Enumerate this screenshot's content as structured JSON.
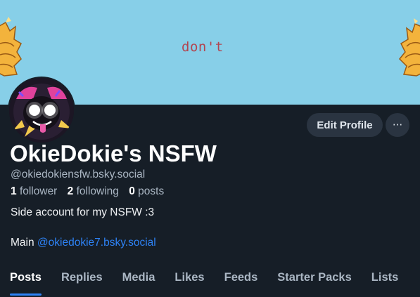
{
  "banner": {
    "text": "don't",
    "background_color": "#87cfe8"
  },
  "profile": {
    "display_name": "OkieDokie's NSFW",
    "handle": "@okiedokiensfw.bsky.social",
    "stats": {
      "followers_count": "1",
      "followers_label": "follower",
      "following_count": "2",
      "following_label": "following",
      "posts_count": "0",
      "posts_label": "posts"
    },
    "bio": {
      "line1": "Side account for my NSFW :3",
      "line2_prefix": "Main",
      "line2_mention": "@okiedokie7.bsky.social"
    }
  },
  "actions": {
    "edit_profile_label": "Edit Profile",
    "more_icon": "ellipsis-icon",
    "more_label": "···"
  },
  "tabs": [
    {
      "label": "Posts",
      "active": true
    },
    {
      "label": "Replies",
      "active": false
    },
    {
      "label": "Media",
      "active": false
    },
    {
      "label": "Likes",
      "active": false
    },
    {
      "label": "Feeds",
      "active": false
    },
    {
      "label": "Starter Packs",
      "active": false
    },
    {
      "label": "Lists",
      "active": false
    }
  ],
  "colors": {
    "page_background": "#161e27",
    "accent": "#2e83f6",
    "muted_text": "#aab6c3",
    "button_background": "#2a3441"
  }
}
